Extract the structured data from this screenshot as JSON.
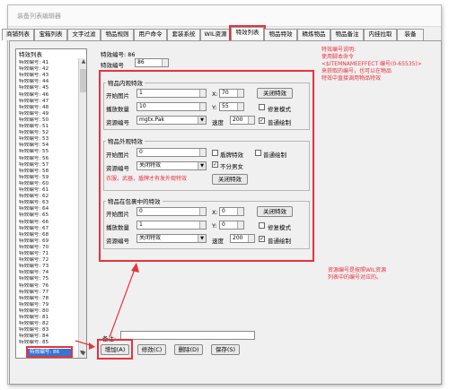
{
  "window": {
    "title": "装备列表编辑器"
  },
  "tabs": [
    "商铺列表",
    "宝箱列表",
    "文字过滤",
    "物品规则",
    "用户命令",
    "套装系统",
    "WIL资源",
    "特效列表",
    "物品特效",
    "精炼物品",
    "物品备注",
    "内挂拉取",
    "装备"
  ],
  "active_tab": 7,
  "list": {
    "header": "特效列表",
    "items": [
      "特效编号: 41",
      "特效编号: 42",
      "特效编号: 43",
      "特效编号: 44",
      "特效编号: 45",
      "特效编号: 46",
      "特效编号: 47",
      "特效编号: 48",
      "特效编号: 49",
      "特效编号: 50",
      "特效编号: 51",
      "特效编号: 52",
      "特效编号: 53",
      "特效编号: 54",
      "特效编号: 55",
      "特效编号: 56",
      "特效编号: 57",
      "特效编号: 58",
      "特效编号: 59",
      "特效编号: 60",
      "特效编号: 61",
      "特效编号: 62",
      "特效编号: 63",
      "特效编号: 64",
      "特效编号: 65",
      "特效编号: 66",
      "特效编号: 67",
      "特效编号: 68",
      "特效编号: 69",
      "特效编号: 70",
      "特效编号: 71",
      "特效编号: 72",
      "特效编号: 73",
      "特效编号: 74",
      "特效编号: 75",
      "特效编号: 76",
      "特效编号: 77",
      "特效编号: 78",
      "特效编号: 79",
      "特效编号: 80",
      "特效编号: 81",
      "特效编号: 82",
      "特效编号: 83",
      "特效编号: 84",
      "特效编号: 85"
    ],
    "selected": "特效编号: 86"
  },
  "header": {
    "title": "特效编号: 86",
    "id_label": "特效编号",
    "id_value": "86"
  },
  "inner": {
    "title": "物品内观特效",
    "start_label": "开始图片",
    "start_value": "1",
    "count_label": "播放数量",
    "count_value": "10",
    "res_label": "资源编号",
    "res_value": "mgtx.Pak",
    "x_label": "X:",
    "x_value": "70",
    "y_label": "Y:",
    "y_value": "55",
    "speed_label": "速度",
    "speed_value": "200",
    "close_btn": "关闭特效",
    "fix_label": "修复模式",
    "normal_label": "普通绘制"
  },
  "outer": {
    "title": "物品外观特效",
    "start_label": "开始图片",
    "start_value": "0",
    "res_label": "资源编号",
    "res_value": "关闭特效",
    "chk1": "盾牌特效",
    "chk2": "普通绘制",
    "chk3": "不分男女",
    "note": "衣服，武器，盾牌才有发外观特效",
    "close_btn": "关闭特效"
  },
  "bag": {
    "title": "物品在包裹中的特效",
    "start_label": "开始图片",
    "start_value": "0",
    "count_label": "播放数量",
    "count_value": "1",
    "res_label": "资源编号",
    "res_value": "关闭特效",
    "x_label": "X:",
    "x_value": "0",
    "y_label": "Y:",
    "y_value": "0",
    "speed_label": "速度",
    "speed_value": "200",
    "close_btn": "关闭特效",
    "fix_label": "修复模式",
    "normal_label": "普通绘制"
  },
  "note": {
    "label": "备注:"
  },
  "buttons": {
    "add": "增加(A)",
    "edit": "修改(C)",
    "delete": "删除(D)",
    "save": "保存(S)"
  },
  "annotations": {
    "top": [
      "特效编号说明:",
      "使用脚本命令",
      "<$ITEMNAMEEFFECT 编号(0-65535)>",
      "来获取的编号，也可以在物品",
      "特效中直接调用物品特效"
    ],
    "bottom": [
      "资源编号是按照WIL资源",
      "列表中的编号对应的。"
    ]
  },
  "colors": {
    "accent_red": "#e8323c",
    "selection": "#3375d6"
  }
}
